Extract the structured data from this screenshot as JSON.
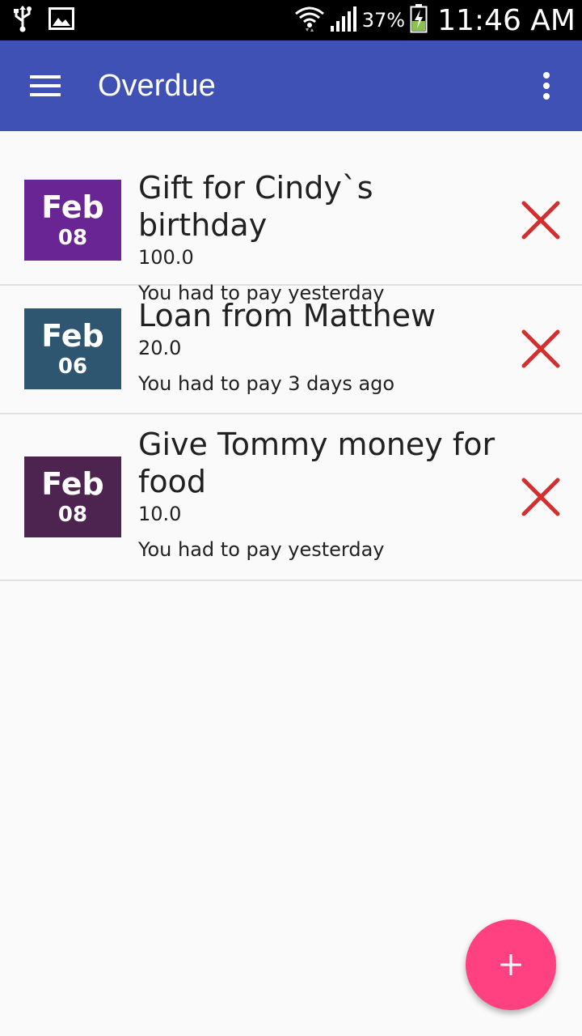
{
  "status_bar": {
    "battery": "37%",
    "time": "11:46 AM",
    "icons": [
      "usb-icon",
      "image-icon",
      "wifi-icon",
      "signal-icon",
      "battery-charging-icon"
    ]
  },
  "app_bar": {
    "title": "Overdue",
    "nav_icon": "menu-icon",
    "action_icon": "overflow-menu-icon",
    "color": "#3f51b5"
  },
  "items": [
    {
      "month": "Feb",
      "day": "08",
      "title": "Gift for Cindy`s birthday",
      "amount": "100.0",
      "status": "You had to pay yesterday",
      "badge_color": "#6a2594"
    },
    {
      "month": "Feb",
      "day": "06",
      "title": "Loan from Matthew",
      "amount": "20.0",
      "status": "You had to pay 3 days ago",
      "badge_color": "#2e5670"
    },
    {
      "month": "Feb",
      "day": "08",
      "title": "Give Tommy money for food",
      "amount": "10.0",
      "status": "You had to pay yesterday",
      "badge_color": "#4d2350"
    }
  ],
  "fab": {
    "icon": "add-icon",
    "color": "#ff4081"
  },
  "delete_color": "#d32f2f"
}
